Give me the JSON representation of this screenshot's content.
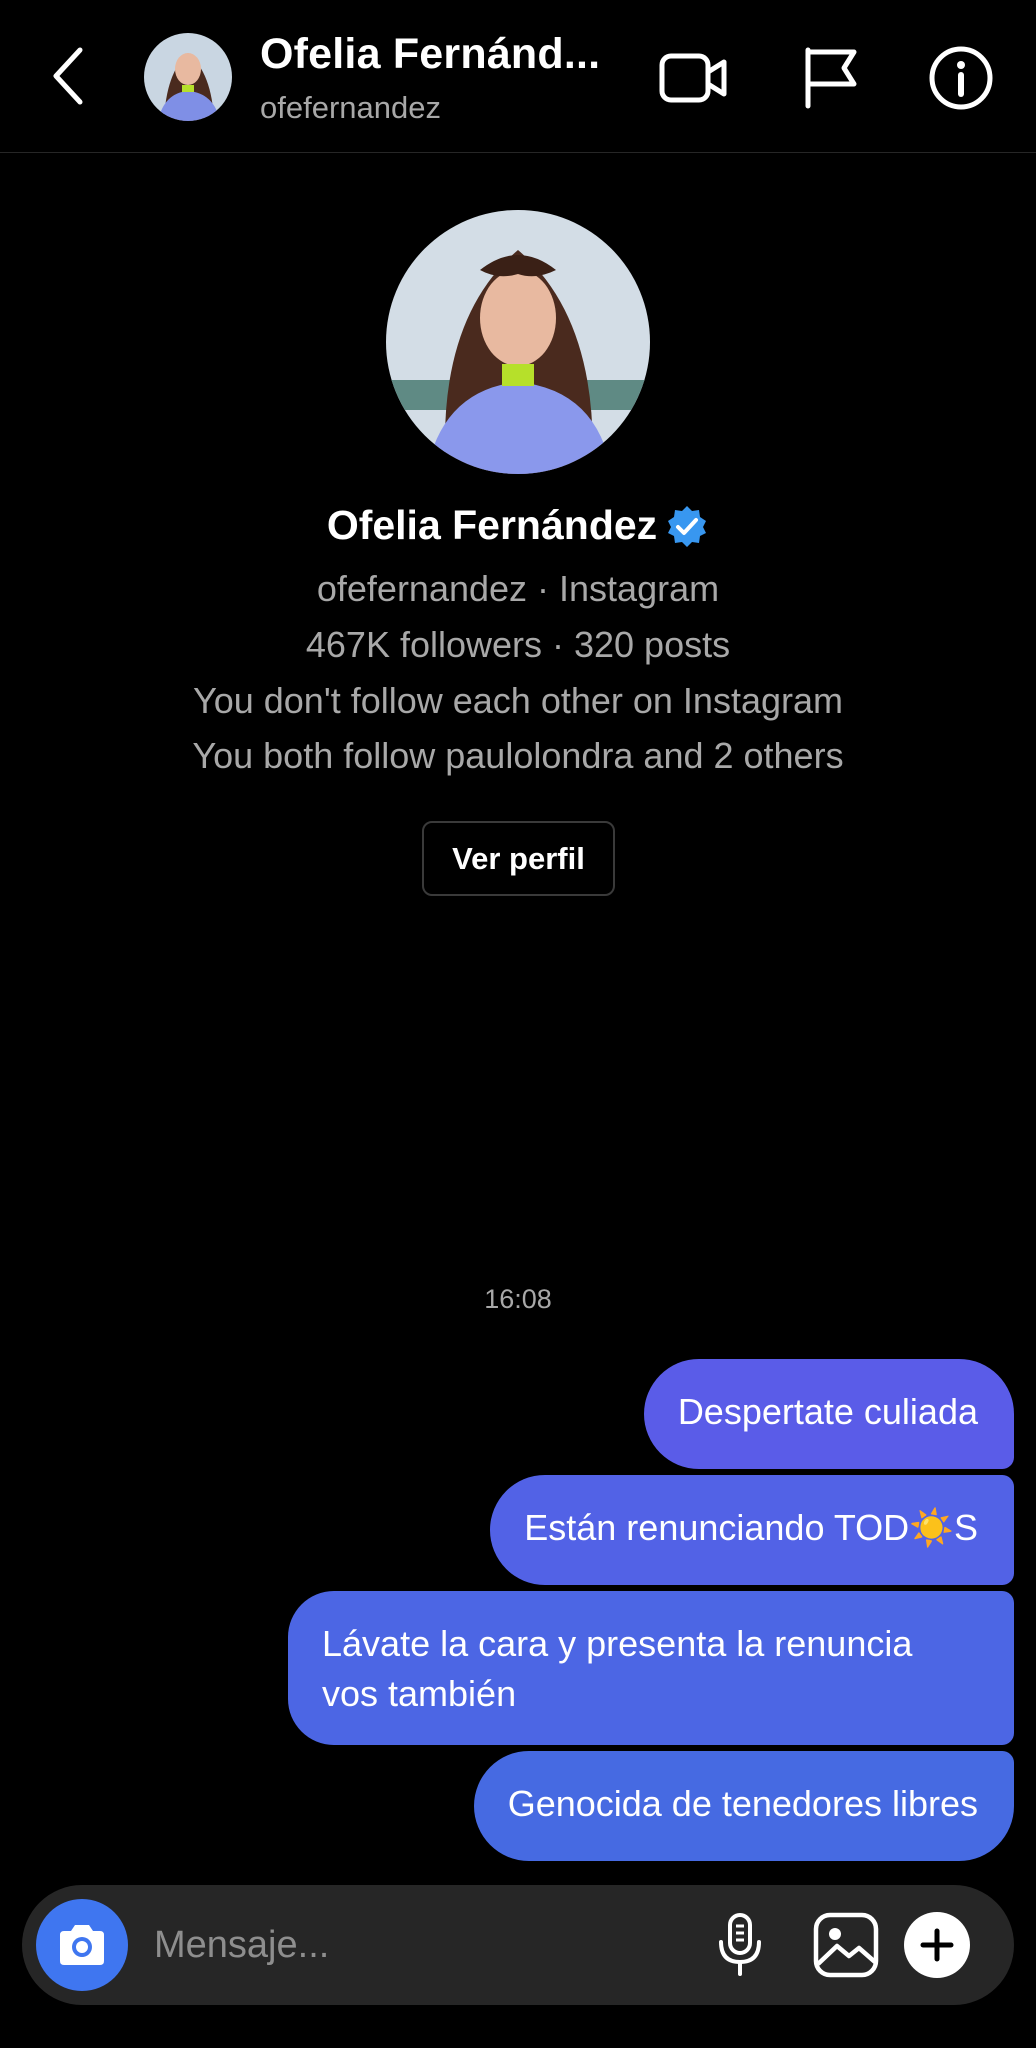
{
  "header": {
    "title": "Ofelia Fernánd...",
    "username": "ofefernandez"
  },
  "profile": {
    "name": "Ofelia Fernández",
    "line1": "ofefernandez · Instagram",
    "line2": "467K followers · 320 posts",
    "line3": "You don't follow each other on Instagram",
    "line4": "You both follow paulolondra and 2 others",
    "view_profile_label": "Ver perfil"
  },
  "messages": {
    "timestamp": "16:08",
    "items": [
      "Despertate culiada",
      "Están renunciando TOD☀️S",
      "Lávate la cara y presenta la renuncia vos también",
      "Genocida de tenedores libres"
    ]
  },
  "composer": {
    "placeholder": "Mensaje..."
  },
  "colors": {
    "bubble": "#5060e6",
    "camera_button": "#3f76f0",
    "verified": "#3897f0",
    "secondary_text": "#a8a8a8"
  }
}
